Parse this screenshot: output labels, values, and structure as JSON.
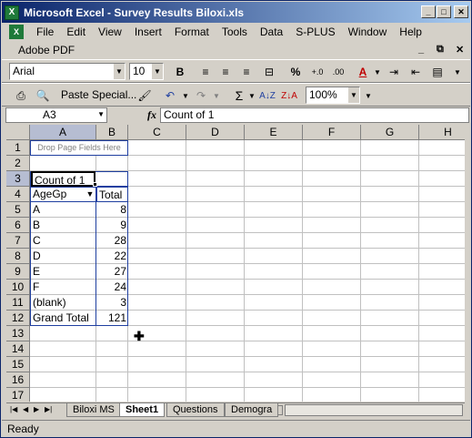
{
  "window": {
    "title": "Microsoft Excel - Survey Results Biloxi.xls",
    "app_icon": "X"
  },
  "menu": [
    "File",
    "Edit",
    "View",
    "Insert",
    "Format",
    "Tools",
    "Data",
    "S-PLUS",
    "Window",
    "Help"
  ],
  "adobe": {
    "label": "Adobe PDF"
  },
  "formatting": {
    "font": "Arial",
    "size": "10",
    "bold": "B"
  },
  "standard": {
    "paste_special": "Paste Special...",
    "sum": "Σ",
    "zoom": "100%"
  },
  "formula": {
    "cell_ref": "A3",
    "fx": "fx",
    "content": "Count of 1"
  },
  "columns": [
    "A",
    "B",
    "C",
    "D",
    "E",
    "F",
    "G",
    "H"
  ],
  "rows": [
    "1",
    "2",
    "3",
    "4",
    "5",
    "6",
    "7",
    "8",
    "9",
    "10",
    "11",
    "12",
    "13",
    "14",
    "15",
    "16",
    "17"
  ],
  "pivot": {
    "page_fields": "Drop Page Fields Here",
    "data_field": "Count of 1",
    "row_field": "AgeGp",
    "col_header": "Total",
    "items": [
      {
        "label": "A",
        "value": "8"
      },
      {
        "label": "B",
        "value": "9"
      },
      {
        "label": "C",
        "value": "28"
      },
      {
        "label": "D",
        "value": "22"
      },
      {
        "label": "E",
        "value": "27"
      },
      {
        "label": "F",
        "value": "24"
      },
      {
        "label": "(blank)",
        "value": "3"
      }
    ],
    "grand_total_label": "Grand Total",
    "grand_total": "121"
  },
  "sheets": [
    "Biloxi MS",
    "Sheet1",
    "Questions",
    "Demogra"
  ],
  "status": "Ready"
}
